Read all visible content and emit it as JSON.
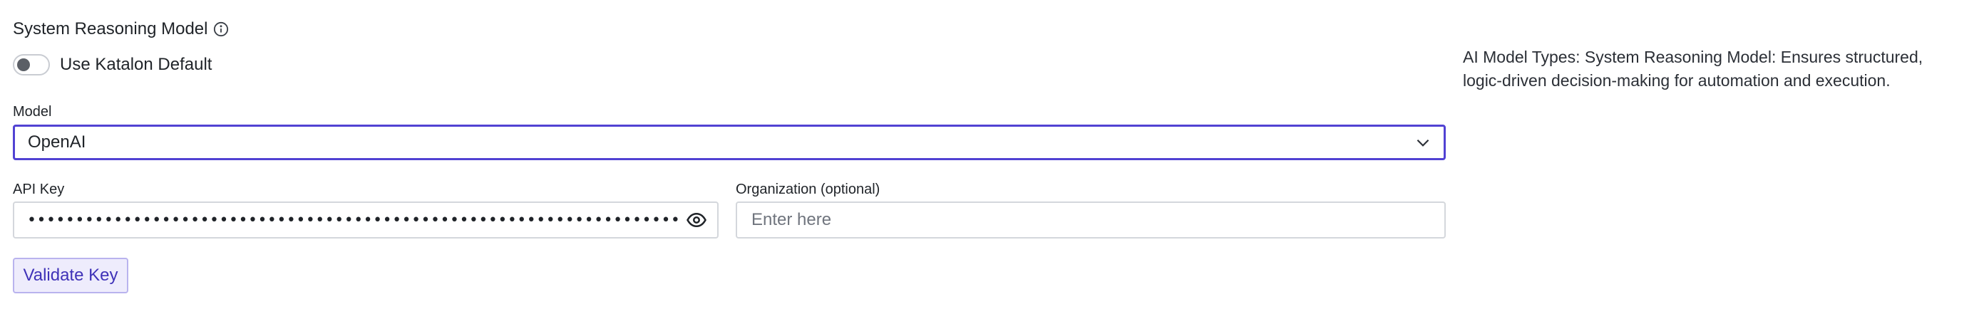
{
  "section": {
    "title": "System Reasoning Model",
    "info_icon": "info-circle-icon"
  },
  "toggle": {
    "label": "Use Katalon Default",
    "checked": false
  },
  "model": {
    "label": "Model",
    "value": "OpenAI",
    "icon": "chevron-down-icon",
    "accent_color": "#5142d3"
  },
  "api_key": {
    "label": "API Key",
    "masked_value": "••••••••••••••••••••••••••••••••••••••••••••••••••••••••••••••••••••••••••••••••••••••",
    "icon": "eye-icon"
  },
  "organization": {
    "label": "Organization (optional)",
    "placeholder": "Enter here",
    "value": ""
  },
  "validate_button": {
    "label": "Validate Key"
  },
  "help": {
    "text": "AI Model Types: System Reasoning Model: Ensures structured, logic-driven decision-making for automation and execution."
  }
}
